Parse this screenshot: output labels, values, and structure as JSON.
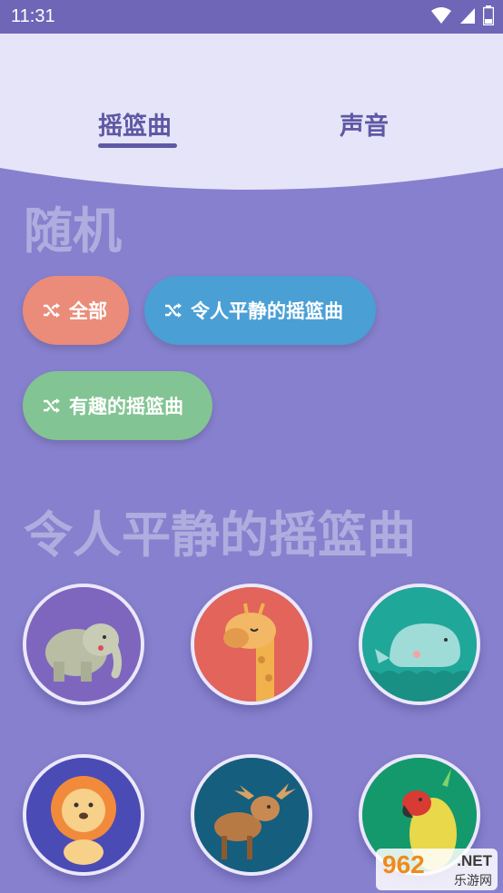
{
  "status_bar": {
    "time": "11:31"
  },
  "tabs": [
    {
      "label": "摇篮曲",
      "selected": true
    },
    {
      "label": "声音",
      "selected": false
    }
  ],
  "sections": {
    "random_title": "随机",
    "calm_title": "令人平静的摇篮曲"
  },
  "chips": [
    {
      "label": "全部",
      "icon": "shuffle-icon",
      "color": "#ea8c79"
    },
    {
      "label": "令人平静的摇篮曲",
      "icon": "shuffle-icon",
      "color": "#4a9fd5"
    },
    {
      "label": "有趣的摇篮曲",
      "icon": "shuffle-icon",
      "color": "#82c493"
    }
  ],
  "lullabies": [
    {
      "animal": "elephant",
      "bg": "#7e66bf"
    },
    {
      "animal": "giraffe",
      "bg": "#e2645a"
    },
    {
      "animal": "whale",
      "bg": "#1fa79a"
    },
    {
      "animal": "lion",
      "bg": "#4b4bb5"
    },
    {
      "animal": "moose",
      "bg": "#155e7e"
    },
    {
      "animal": "parrot",
      "bg": "#14996c"
    }
  ],
  "watermark": {
    "number": "962",
    "suffix": ".NET",
    "text": "乐游网"
  },
  "colors": {
    "background": "#8780ce",
    "header": "#e6e4f8",
    "accent": "#5f58a4"
  }
}
